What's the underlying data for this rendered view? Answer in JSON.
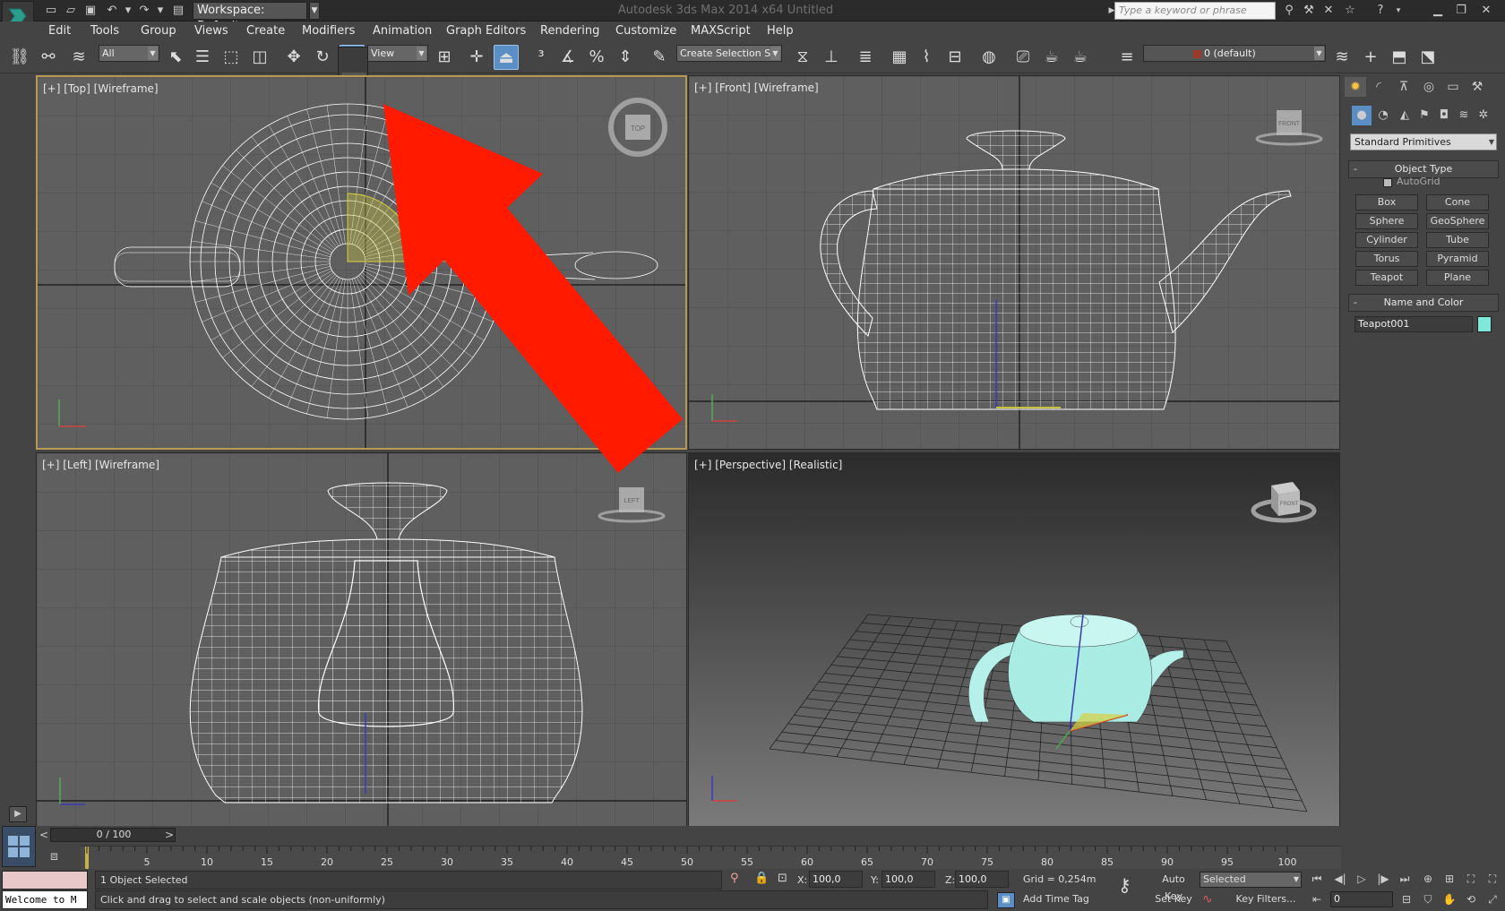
{
  "titlebar": {
    "workspace": "Workspace: Default",
    "app_title": "Autodesk 3ds Max  2014 x64    Untitled",
    "search_placeholder": "Type a keyword or phrase"
  },
  "menu": [
    "Edit",
    "Tools",
    "Group",
    "Views",
    "Create",
    "Modifiers",
    "Animation",
    "Graph Editors",
    "Rendering",
    "Customize",
    "MAXScript",
    "Help"
  ],
  "toolbar": {
    "selection_filter": "All",
    "ref_coord": "View",
    "named_selection": "Create Selection Set",
    "layer": "0 (default)"
  },
  "viewports": {
    "top": "[+] [Top] [Wireframe]",
    "front": "[+] [Front] [Wireframe]",
    "left": "[+] [Left] [Wireframe]",
    "perspective": "[+] [Perspective] [Realistic]",
    "viewcube_top": "TOP",
    "viewcube_front": "FRONT",
    "viewcube_left": "LEFT",
    "viewcube_persp": "FRONT"
  },
  "command_panel": {
    "category": "Standard Primitives",
    "object_type_title": "Object Type",
    "autogrid": "AutoGrid",
    "buttons": [
      "Box",
      "Cone",
      "Sphere",
      "GeoSphere",
      "Cylinder",
      "Tube",
      "Torus",
      "Pyramid",
      "Teapot",
      "Plane"
    ],
    "name_color_title": "Name and Color",
    "object_name": "Teapot001",
    "object_color": "#7fe8d8"
  },
  "timeline": {
    "slider": "0 / 100",
    "ticks": [
      "5",
      "10",
      "15",
      "20",
      "25",
      "30",
      "35",
      "40",
      "45",
      "50",
      "55",
      "60",
      "65",
      "70",
      "75",
      "80",
      "85",
      "90",
      "95",
      "100"
    ]
  },
  "status": {
    "maxscript": "Welcome to M",
    "selection": "1 Object Selected",
    "prompt": "Click and drag to select and scale objects (non-uniformly)",
    "x_label": "X:",
    "x": "100,0",
    "y_label": "Y:",
    "y": "100,0",
    "z_label": "Z:",
    "z": "100,0",
    "grid": "Grid = 0,254m",
    "add_time_tag": "Add Time Tag",
    "auto_key": "Auto Key",
    "set_key": "Set Key",
    "selected": "Selected",
    "key_filters": "Key Filters...",
    "frame": "0"
  },
  "colors": {
    "annotation_arrow": "#ff1a00",
    "active_viewport_border": "#b79b53",
    "active_tool": "#5a8ec4"
  }
}
